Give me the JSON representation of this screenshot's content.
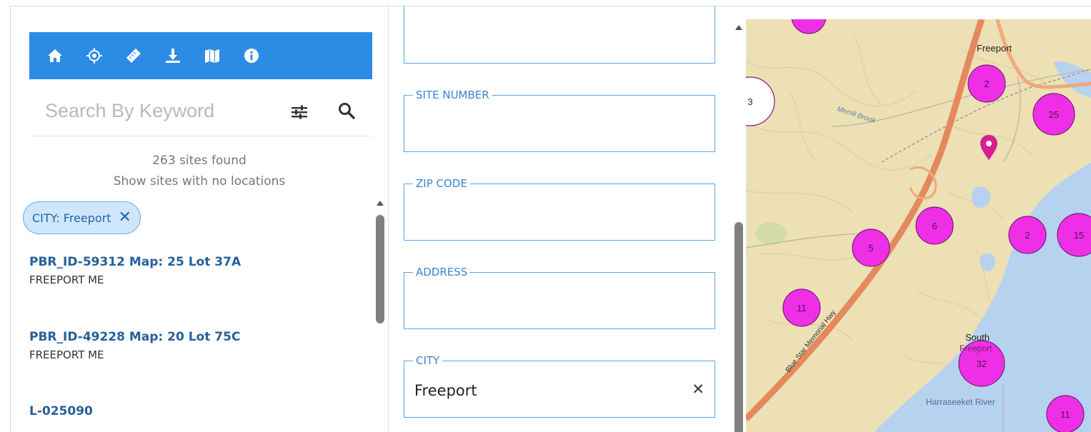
{
  "toolbar": {
    "buttons": [
      {
        "name": "home-icon",
        "label": "Home"
      },
      {
        "name": "locate-icon",
        "label": "Locate"
      },
      {
        "name": "ruler-icon",
        "label": "Measure"
      },
      {
        "name": "download-icon",
        "label": "Download"
      },
      {
        "name": "map-icon",
        "label": "Basemap"
      },
      {
        "name": "info-icon",
        "label": "Info"
      }
    ]
  },
  "search": {
    "placeholder": "Search By Keyword",
    "value": ""
  },
  "results": {
    "count_text": "263 sites found",
    "no_locations_link": "Show sites with no locations",
    "filter_chip": "CITY: Freeport",
    "items": [
      {
        "title": "PBR_ID-59312 Map: 25 Lot 37A",
        "subtitle": "FREEPORT ME"
      },
      {
        "title": "PBR_ID-49228 Map: 20 Lot 75C",
        "subtitle": "FREEPORT ME"
      },
      {
        "title": "L-025090",
        "subtitle": ""
      }
    ]
  },
  "form": {
    "fields": [
      {
        "label": "",
        "value": ""
      },
      {
        "label": "SITE NUMBER",
        "value": ""
      },
      {
        "label": "ZIP CODE",
        "value": ""
      },
      {
        "label": "ADDRESS",
        "value": ""
      },
      {
        "label": "CITY",
        "value": "Freeport"
      }
    ],
    "clear_symbol": "✕"
  },
  "map": {
    "labels": {
      "freeport": "Freeport",
      "south": "South",
      "south_freeport": "Freeport",
      "brook": "Merrill Brook",
      "highway": "Blue Star Memorial Hwy",
      "river": "Harraseeket River"
    },
    "clusters": [
      {
        "count": "3"
      },
      {
        "count": "2"
      },
      {
        "count": "25"
      },
      {
        "count": "6"
      },
      {
        "count": "2"
      },
      {
        "count": "15"
      },
      {
        "count": "5"
      },
      {
        "count": "11"
      },
      {
        "count": "32"
      },
      {
        "count": "11"
      }
    ],
    "colors": {
      "cluster": "#ee2fe6",
      "land": "#ece0b4",
      "water": "#b7d2ee",
      "highway": "#e4895e"
    }
  }
}
